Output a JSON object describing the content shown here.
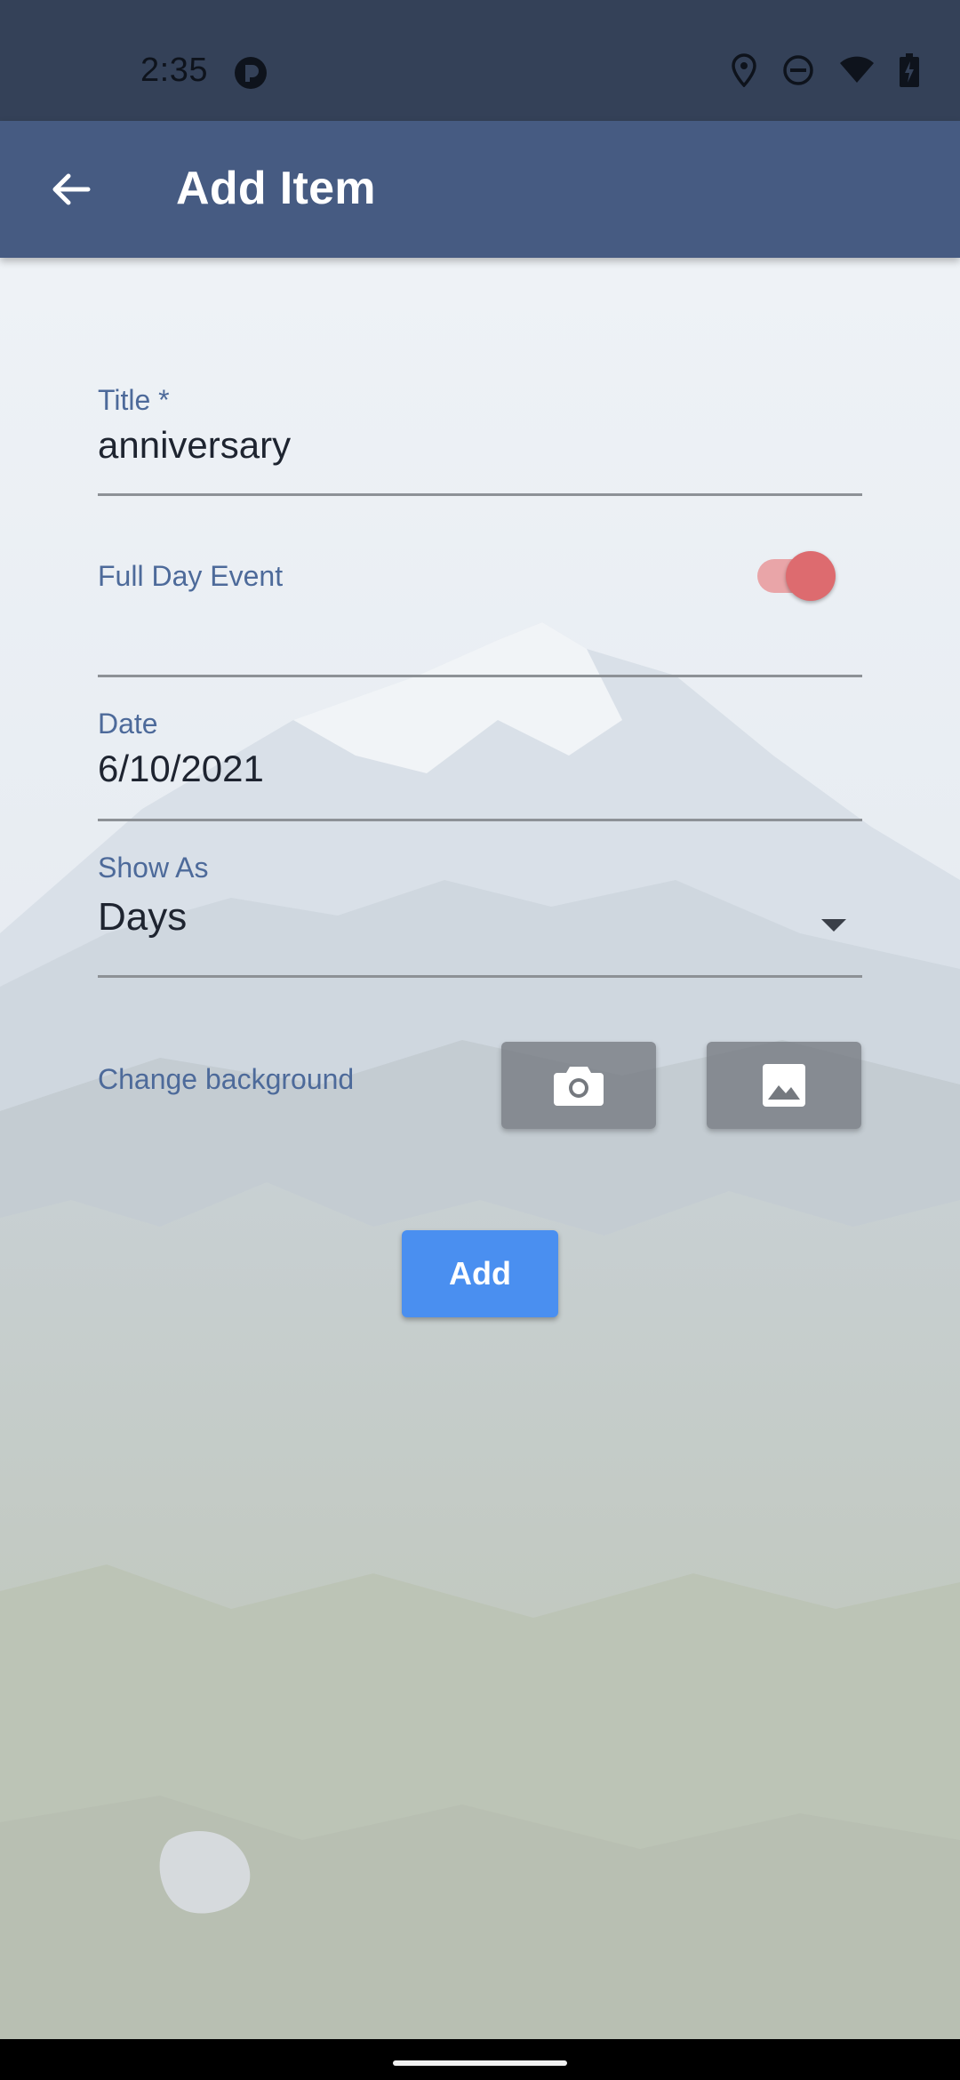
{
  "status_bar": {
    "time": "2:35",
    "icons": [
      "app-notification-icon",
      "location-icon",
      "do-not-disturb-icon",
      "wifi-icon",
      "battery-icon"
    ]
  },
  "app_bar": {
    "title": "Add Item",
    "back_icon": "arrow-back-icon"
  },
  "form": {
    "title_field": {
      "label": "Title *",
      "value": "anniversary"
    },
    "full_day_event": {
      "label": "Full Day Event",
      "enabled": true
    },
    "date_field": {
      "label": "Date",
      "value": "6/10/2021"
    },
    "show_as": {
      "label": "Show As",
      "selected": "Days"
    },
    "background": {
      "label": "Change background",
      "camera_icon": "camera-icon",
      "gallery_icon": "image-icon"
    },
    "add_button": {
      "label": "Add"
    }
  },
  "colors": {
    "status_bar": "#344158",
    "app_bar": "#465b82",
    "label": "#4d6a9a",
    "toggle_on": "#dd6b6f",
    "add_button": "#4a8ff0"
  }
}
